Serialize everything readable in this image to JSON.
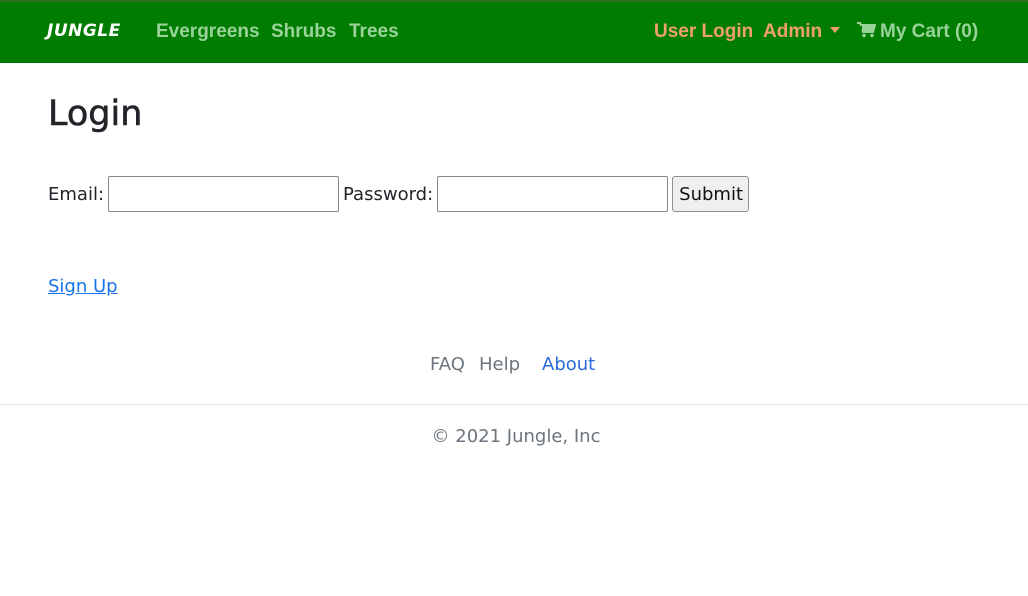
{
  "navbar": {
    "brand": "JUNGLE",
    "links": [
      "Evergreens",
      "Shrubs",
      "Trees"
    ],
    "user_login": "User Login",
    "admin": "Admin",
    "cart": "My Cart (0)",
    "colors": {
      "background": "#007d00",
      "link": "#9ad39a",
      "accent": "#f0a070"
    }
  },
  "main": {
    "title": "Login",
    "email_label": "Email:",
    "email_value": "",
    "password_label": "Password:",
    "password_value": "",
    "submit_label": "Submit",
    "signup_link": "Sign Up"
  },
  "footer": {
    "links": [
      "FAQ",
      "Help",
      "About"
    ],
    "copyright": "© 2021 Jungle, Inc"
  }
}
